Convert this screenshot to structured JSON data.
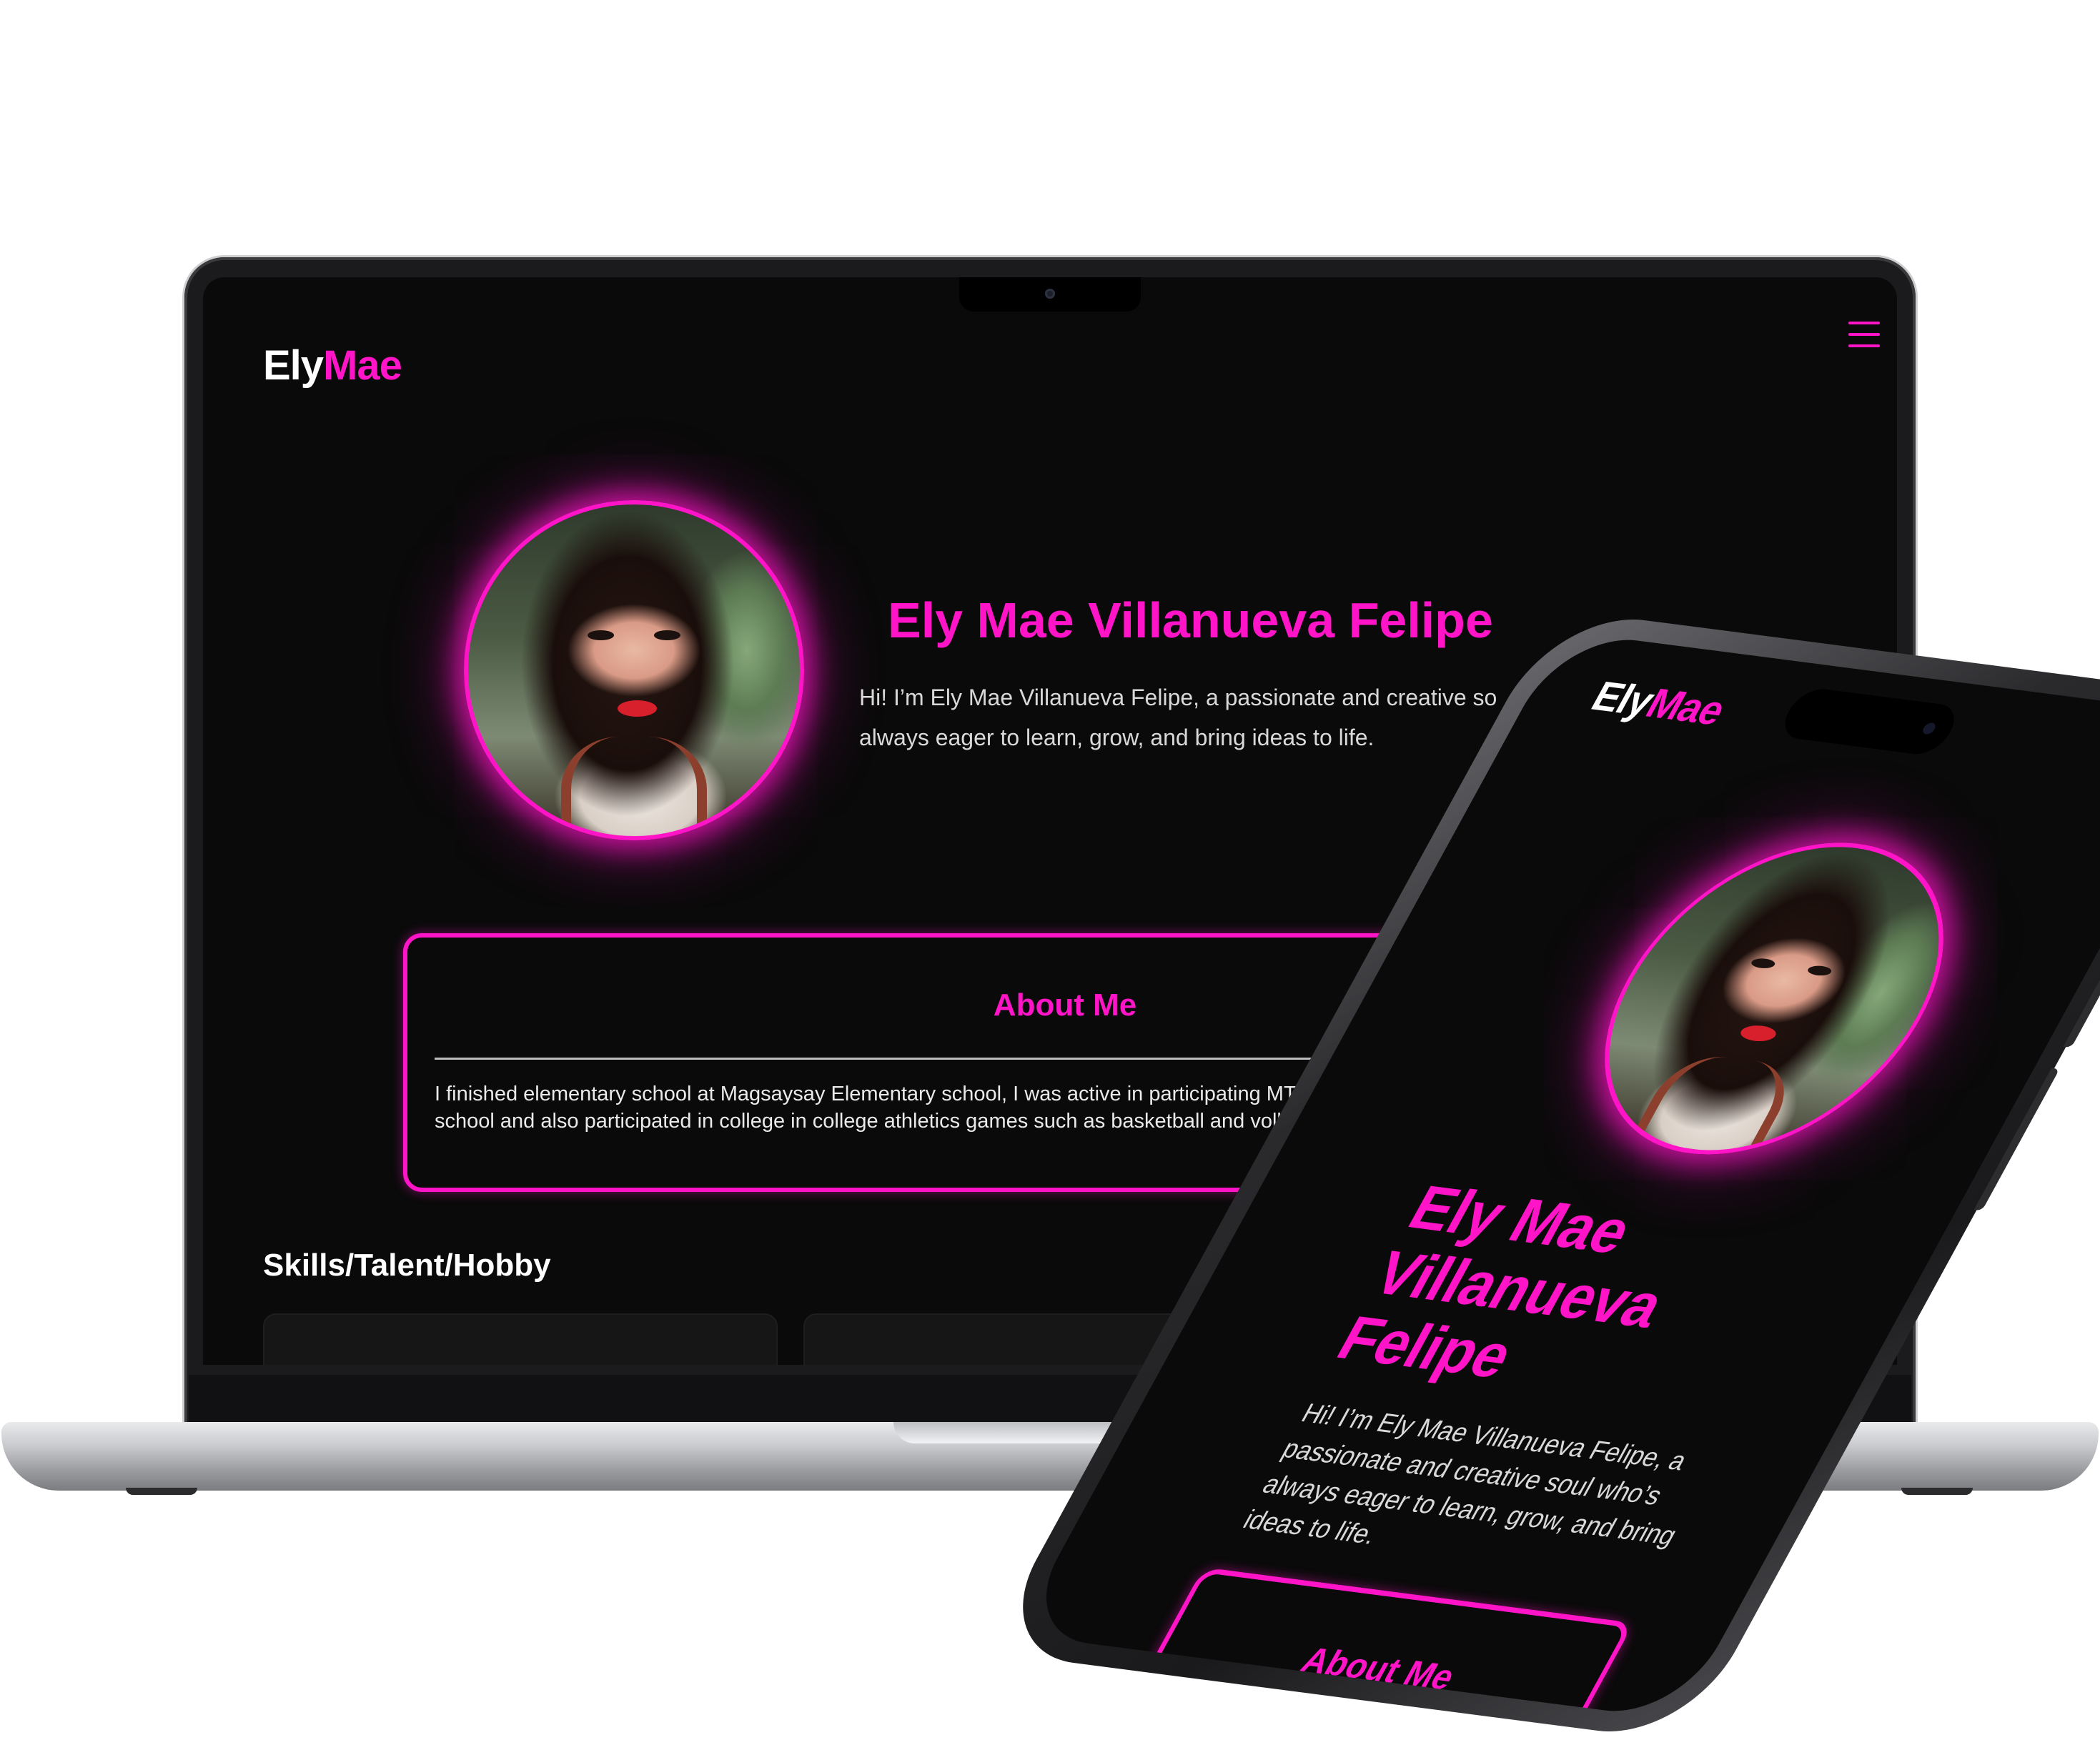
{
  "site": {
    "logo_part1": "Ely",
    "logo_part2": "Mae",
    "name": "Ely Mae Villanueva Felipe",
    "bio_line1": "Hi! I’m Ely Mae Villanueva Felipe, a passionate and creative so",
    "bio_line2": "always eager to learn, grow, and bring ideas to life.",
    "about_title": "About Me",
    "about_line1": "I finished elementary school at Magsaysay Elementary school, I was active in participating MT(",
    "about_line2": "school and also participated in college in college athletics games such as basketball and volle",
    "skills_title": "Skills/Talent/Hobby",
    "menu_icon": "hamburger-menu-icon"
  },
  "mobile": {
    "logo_part1": "Ely",
    "logo_part2": "Mae",
    "name": "Ely Mae Villanueva Felipe",
    "bio": "Hi! I’m Ely Mae Villanueva Felipe, a passionate and creative soul who’s always eager to learn, grow, and bring ideas to life.",
    "about_title": "About Me"
  },
  "colors": {
    "accent": "#ff14c8",
    "background": "#0a0a0a",
    "text": "#d9d9d9"
  }
}
